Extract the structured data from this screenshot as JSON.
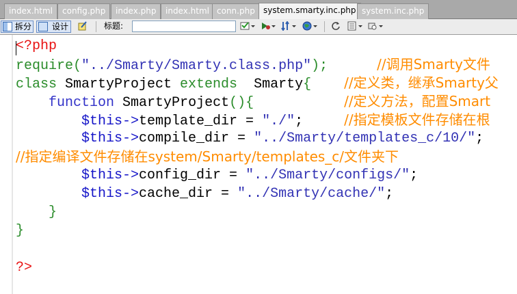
{
  "tabs": [
    {
      "label": "index.html",
      "active": false
    },
    {
      "label": "config.php",
      "active": false
    },
    {
      "label": "index.php",
      "active": false
    },
    {
      "label": "index.html",
      "active": false
    },
    {
      "label": "conn.php",
      "active": false
    },
    {
      "label": "system.smarty.inc.php",
      "active": true
    },
    {
      "label": "system.inc.php",
      "active": false
    }
  ],
  "toolbar": {
    "split_label": "拆分",
    "design_label": "设计",
    "title_label": "标题:",
    "title_value": "",
    "icons": [
      "code-view-icon",
      "split-view-icon",
      "design-view-icon",
      "live-edit-icon",
      "file-management-icon",
      "preview-in-browser-icon",
      "debug-icon",
      "globe-icon",
      "refresh-icon",
      "view-options-icon",
      "visual-aids-icon"
    ]
  },
  "colors": {
    "php_tag": "#e81010",
    "keyword": "#2a8c2a",
    "function_keyword": "#3232c8",
    "string": "#3232b4",
    "comment": "#ff8c00",
    "variable": "#1414c8",
    "plain": "#000000"
  },
  "editor": {
    "lines": [
      {
        "segments": [
          {
            "t": "<?php",
            "c": "php_tag"
          }
        ]
      },
      {
        "segments": [
          {
            "t": "require(",
            "c": "keyword"
          },
          {
            "t": "\"../Smarty/Smarty.class.php\"",
            "c": "string"
          },
          {
            "t": ");      ",
            "c": "keyword"
          },
          {
            "t": "//调用Smarty文件",
            "c": "comment"
          }
        ]
      },
      {
        "segments": [
          {
            "t": "class ",
            "c": "keyword"
          },
          {
            "t": "SmartyProject ",
            "c": "plain"
          },
          {
            "t": "extends  ",
            "c": "keyword"
          },
          {
            "t": "Smarty",
            "c": "plain"
          },
          {
            "t": "{    ",
            "c": "keyword"
          },
          {
            "t": "//定义类，继承Smarty父",
            "c": "comment"
          }
        ]
      },
      {
        "segments": [
          {
            "t": "    ",
            "c": "plain"
          },
          {
            "t": "function ",
            "c": "function_keyword"
          },
          {
            "t": "SmartyProject",
            "c": "plain"
          },
          {
            "t": "(){           ",
            "c": "keyword"
          },
          {
            "t": "//定义方法，配置Smart",
            "c": "comment"
          }
        ]
      },
      {
        "segments": [
          {
            "t": "        ",
            "c": "plain"
          },
          {
            "t": "$this->",
            "c": "variable"
          },
          {
            "t": "template_dir = ",
            "c": "plain"
          },
          {
            "t": "\"./\"",
            "c": "string"
          },
          {
            "t": ";     ",
            "c": "plain"
          },
          {
            "t": "//指定模板文件存储在根",
            "c": "comment"
          }
        ]
      },
      {
        "segments": [
          {
            "t": "        ",
            "c": "plain"
          },
          {
            "t": "$this->",
            "c": "variable"
          },
          {
            "t": "compile_dir = ",
            "c": "plain"
          },
          {
            "t": "\"../Smarty/templates_c/10/\"",
            "c": "string"
          },
          {
            "t": ";",
            "c": "plain"
          }
        ]
      },
      {
        "segments": [
          {
            "t": "//指定编译文件存储在system/Smarty/templates_c/文件夹下",
            "c": "comment"
          }
        ]
      },
      {
        "segments": [
          {
            "t": "        ",
            "c": "plain"
          },
          {
            "t": "$this->",
            "c": "variable"
          },
          {
            "t": "config_dir = ",
            "c": "plain"
          },
          {
            "t": "\"../Smarty/configs/\"",
            "c": "string"
          },
          {
            "t": ";",
            "c": "plain"
          }
        ]
      },
      {
        "segments": [
          {
            "t": "        ",
            "c": "plain"
          },
          {
            "t": "$this->",
            "c": "variable"
          },
          {
            "t": "cache_dir = ",
            "c": "plain"
          },
          {
            "t": "\"../Smarty/cache/\"",
            "c": "string"
          },
          {
            "t": ";",
            "c": "plain"
          }
        ]
      },
      {
        "segments": [
          {
            "t": "    }",
            "c": "keyword"
          }
        ]
      },
      {
        "segments": [
          {
            "t": "}",
            "c": "keyword"
          }
        ]
      },
      {
        "segments": []
      },
      {
        "segments": [
          {
            "t": "?>",
            "c": "php_tag"
          }
        ]
      }
    ]
  }
}
